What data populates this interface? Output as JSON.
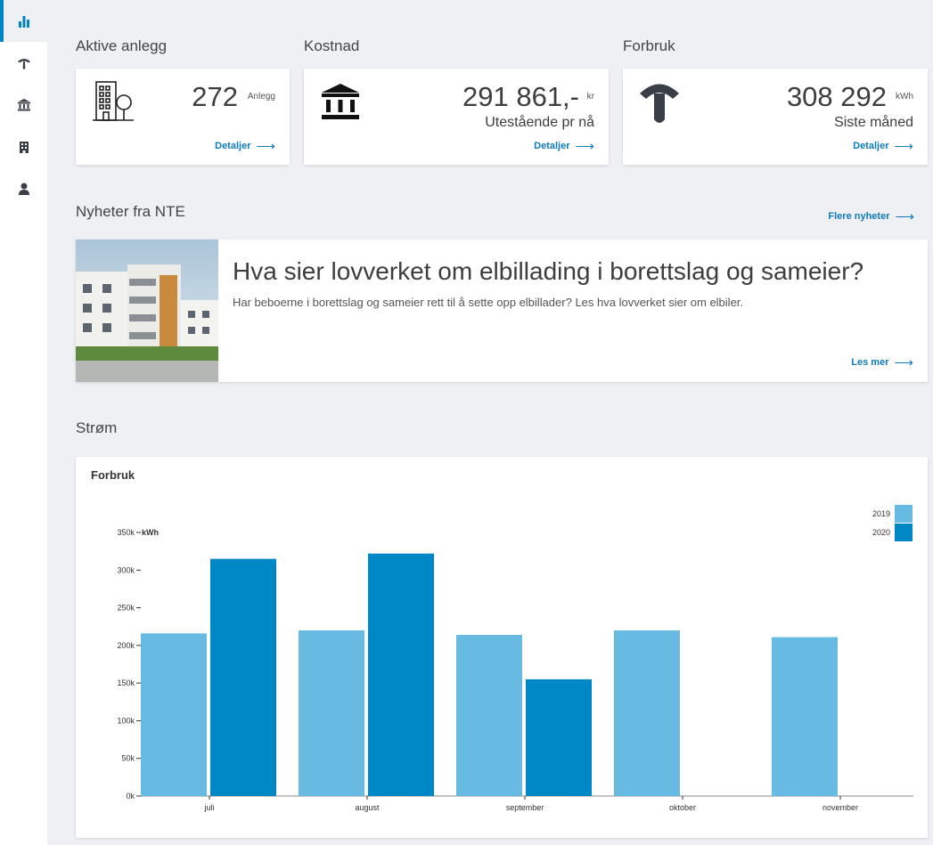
{
  "sidebar": {
    "items": [
      {
        "icon": "bar-chart-icon",
        "active": true
      },
      {
        "icon": "gauge-icon",
        "active": false
      },
      {
        "icon": "bank-icon",
        "active": false
      },
      {
        "icon": "building-icon",
        "active": false
      },
      {
        "icon": "user-icon",
        "active": false
      }
    ]
  },
  "cards": {
    "anlegg": {
      "title": "Aktive anlegg",
      "value": "272",
      "unit": "Anlegg",
      "link": "Detaljer"
    },
    "kostnad": {
      "title": "Kostnad",
      "value": "291 861,-",
      "unit": "kr",
      "sub": "Utestående pr nå",
      "link": "Detaljer"
    },
    "forbruk": {
      "title": "Forbruk",
      "value": "308 292",
      "unit": "kWh",
      "sub": "Siste måned",
      "link": "Detaljer"
    }
  },
  "news": {
    "section_title": "Nyheter fra NTE",
    "more_link": "Flere nyheter",
    "title": "Hva sier lovverket om elbillading i borettslag og sameier?",
    "text": "Har beboerne i borettslag og sameier rett til å sette opp elbillader? Les hva lovverket sier om elbiler.",
    "read_more": "Les mer"
  },
  "strom": {
    "section_title": "Strøm"
  },
  "colors": {
    "accent": "#0085c3",
    "series_2019": "#67bbe2",
    "series_2020": "#0088c6"
  },
  "chart_data": {
    "type": "bar",
    "title": "Forbruk",
    "ylabel": "kWh",
    "ylim": [
      0,
      350000
    ],
    "yticks": [
      "0k",
      "50k",
      "100k",
      "150k",
      "200k",
      "250k",
      "300k",
      "350k"
    ],
    "categories": [
      "juli",
      "august",
      "september",
      "oktober",
      "november"
    ],
    "series": [
      {
        "name": "2019",
        "values": [
          216000,
          220000,
          214000,
          220000,
          211000
        ]
      },
      {
        "name": "2020",
        "values": [
          315000,
          322000,
          155000,
          null,
          null
        ]
      }
    ],
    "legend": "top-right"
  }
}
